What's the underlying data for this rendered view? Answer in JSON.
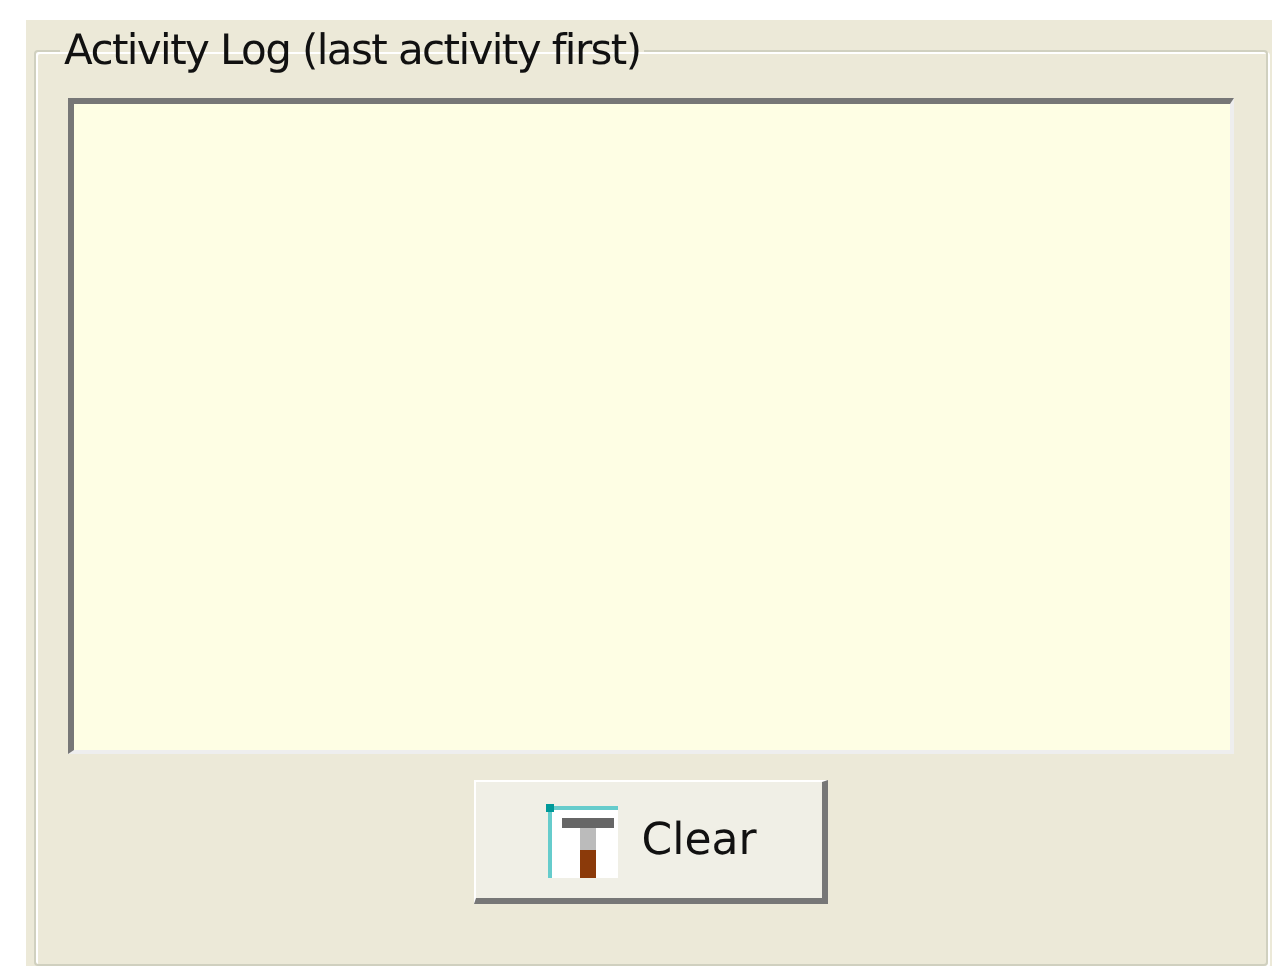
{
  "group": {
    "title": "Activity Log (last activity first)"
  },
  "clear_button": {
    "label": "Clear"
  }
}
